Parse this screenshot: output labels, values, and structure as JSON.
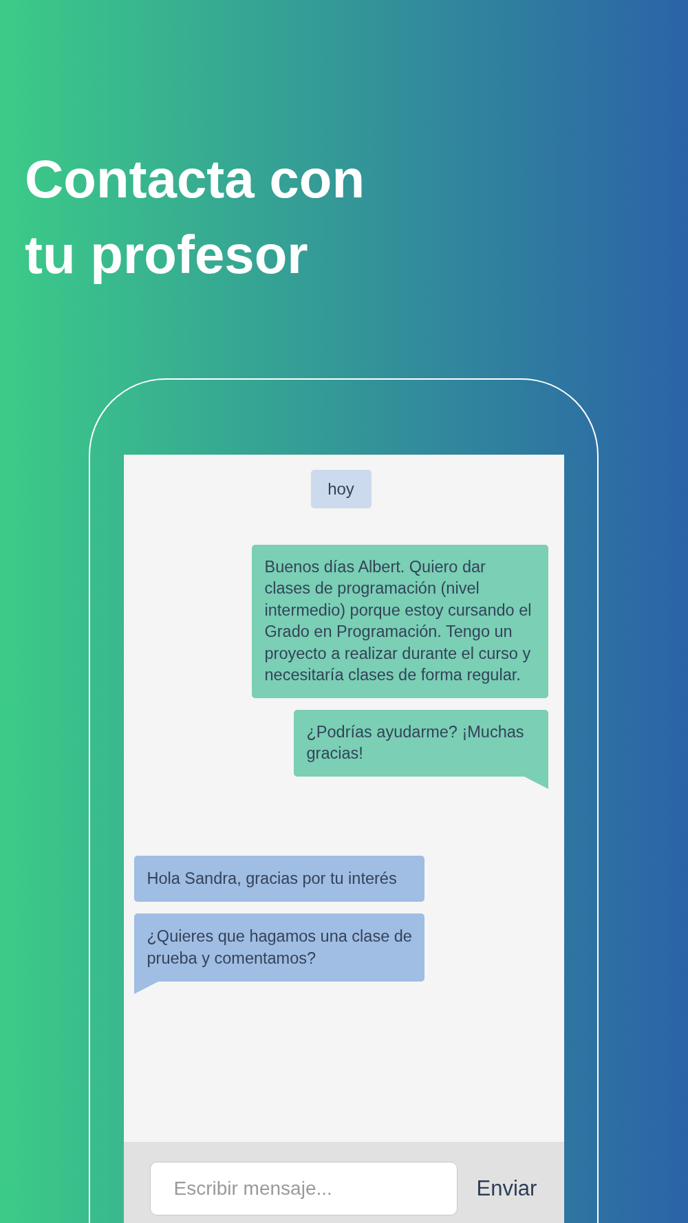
{
  "headline": "Contacta con tu profesor",
  "chat": {
    "date_chip": "hoy",
    "messages": [
      {
        "kind": "sent",
        "text": "Buenos días Albert. Quiero dar clases de programación (nivel intermedio) porque estoy cursando el Grado en Programación. Tengo un proyecto a realizar durante el curso y necesitaría clases de forma regular.",
        "tail": false
      },
      {
        "kind": "sent",
        "text": "¿Podrías ayudarme? ¡Muchas gracias!",
        "tail": true
      },
      {
        "kind": "received",
        "text": "Hola Sandra, gracias por tu interés",
        "tail": false
      },
      {
        "kind": "received",
        "text": "¿Quieres que hagamos una clase de prueba y comentamos?",
        "tail": true
      }
    ]
  },
  "composer": {
    "placeholder": "Escribir mensaje...",
    "send_button": "Enviar"
  }
}
